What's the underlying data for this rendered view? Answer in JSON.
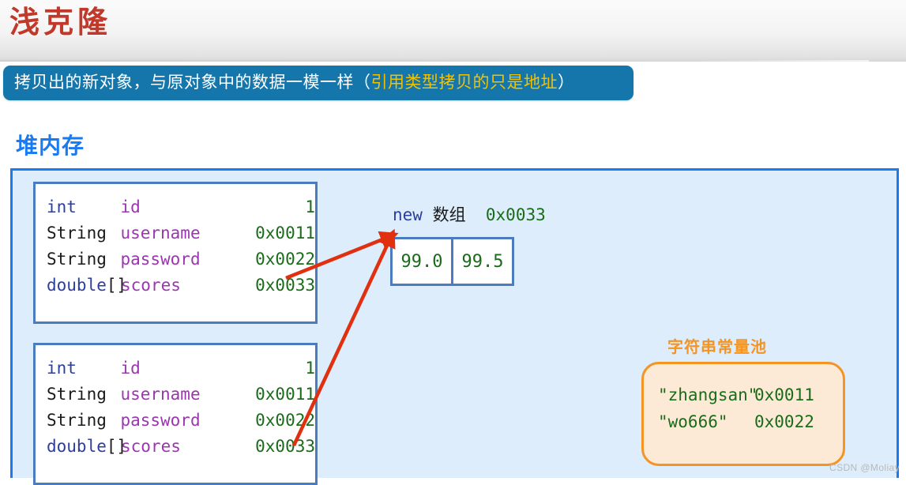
{
  "header": {
    "title": "浅克隆"
  },
  "banner": {
    "text_before": "拷贝出的新对象，与原对象中的数据一模一样（",
    "highlight": "引用类型拷贝的只是地址",
    "text_after": "）",
    "bg_color": "#1576ab",
    "highlight_color": "#f2c200"
  },
  "heap": {
    "label": "堆内存",
    "label_color": "#1a7af0",
    "border_color": "#1a7af0",
    "fill_color": "#ddedfb"
  },
  "objects": [
    {
      "name": "original-object",
      "rows": [
        {
          "type": "int",
          "brackets": "",
          "field": "id",
          "value": "1"
        },
        {
          "type": "String",
          "brackets": "",
          "field": "username",
          "value": "0x0011"
        },
        {
          "type": "String",
          "brackets": "",
          "field": "password",
          "value": "0x0022"
        },
        {
          "type": "double",
          "brackets": "[]",
          "field": "scores",
          "value": "0x0033"
        }
      ]
    },
    {
      "name": "cloned-object",
      "rows": [
        {
          "type": "int",
          "brackets": "",
          "field": "id",
          "value": "1"
        },
        {
          "type": "String",
          "brackets": "",
          "field": "username",
          "value": "0x0011"
        },
        {
          "type": "String",
          "brackets": "",
          "field": "password",
          "value": "0x0022"
        },
        {
          "type": "double",
          "brackets": "[]",
          "field": "scores",
          "value": "0x0033"
        }
      ]
    }
  ],
  "array": {
    "keyword": "new",
    "label": "数组",
    "address": "0x0033",
    "cells": [
      "99.0",
      "99.5"
    ]
  },
  "string_pool": {
    "label": "字符串常量池",
    "label_color": "#f39423",
    "border_color": "#f39423",
    "fill_color": "#fce9d6",
    "rows": [
      {
        "literal": "\"zhangsan\"",
        "address": "0x0011"
      },
      {
        "literal": "\"wo666\"",
        "address": "0x0022"
      }
    ]
  },
  "arrows": {
    "color": "#e03010",
    "count": 2
  },
  "watermark": {
    "text": "CSDN @Moliay"
  }
}
